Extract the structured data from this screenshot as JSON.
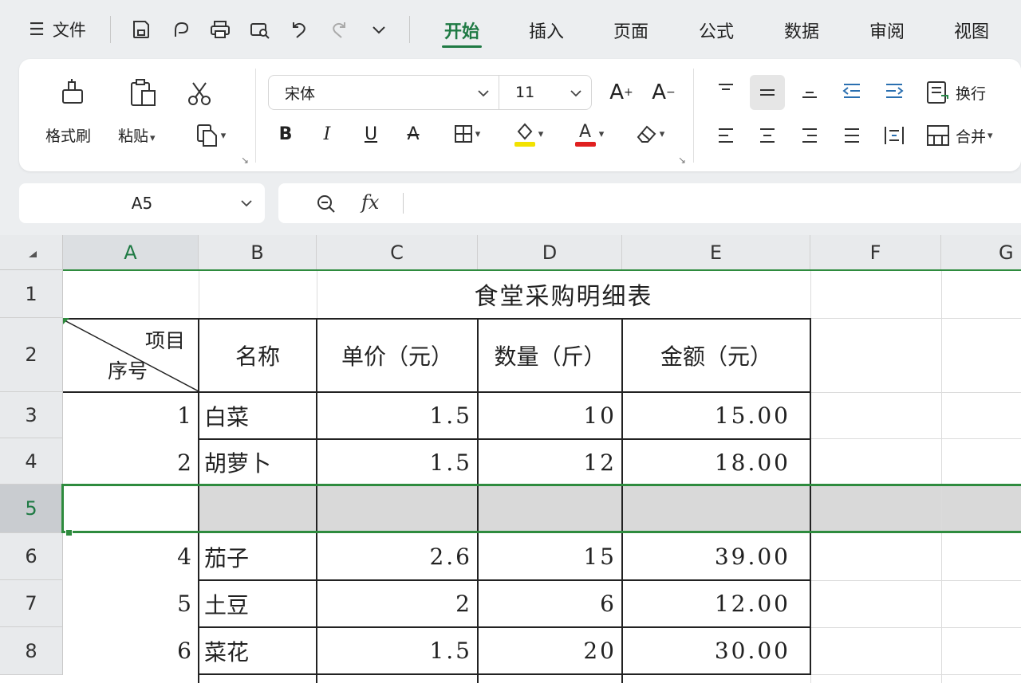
{
  "menubar": {
    "file_label": "文件",
    "tabs": [
      "开始",
      "插入",
      "页面",
      "公式",
      "数据",
      "审阅",
      "视图"
    ]
  },
  "ribbon": {
    "format_painter": "格式刷",
    "paste": "粘贴",
    "font_name": "宋体",
    "font_size": "11",
    "wrap": "换行",
    "merge": "合并",
    "font_color": "#e02020",
    "highlight_color": "#f2e200"
  },
  "formula_bar": {
    "cell_ref": "A5",
    "fx": "fx"
  },
  "sheet": {
    "columns": [
      "A",
      "B",
      "C",
      "D",
      "E",
      "F",
      "G"
    ],
    "rows": [
      "1",
      "2",
      "3",
      "4",
      "5",
      "6",
      "7",
      "8"
    ],
    "title": "食堂采购明细表",
    "diag_top": "项目",
    "diag_bottom": "序号",
    "headers": [
      "名称",
      "单价（元）",
      "数量（斤）",
      "金额（元）"
    ],
    "data": [
      {
        "seq": "1",
        "name": "白菜",
        "price": "1.5",
        "qty": "10",
        "amount": "15.00"
      },
      {
        "seq": "2",
        "name": "胡萝卜",
        "price": "1.5",
        "qty": "12",
        "amount": "18.00"
      },
      {
        "seq": "",
        "name": "",
        "price": "",
        "qty": "",
        "amount": ""
      },
      {
        "seq": "4",
        "name": "茄子",
        "price": "2.6",
        "qty": "15",
        "amount": "39.00"
      },
      {
        "seq": "5",
        "name": "土豆",
        "price": "2",
        "qty": "6",
        "amount": "12.00"
      },
      {
        "seq": "6",
        "name": "菜花",
        "price": "1.5",
        "qty": "20",
        "amount": "30.00"
      }
    ]
  },
  "colors": {
    "accent": "#1f7a44",
    "selection": "#2e8b3e"
  }
}
